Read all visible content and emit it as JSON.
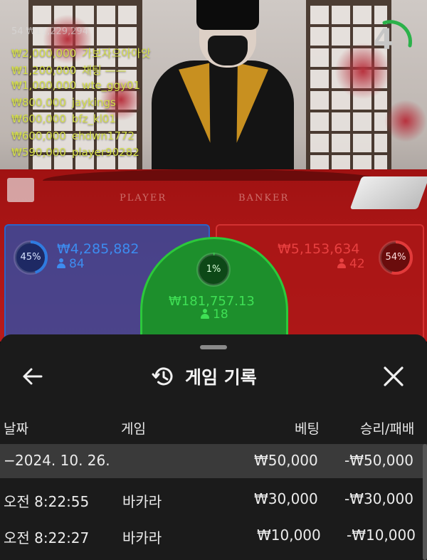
{
  "countdown": {
    "value": "4",
    "color": "#2bb14a"
  },
  "chat": {
    "header": "54 ₩11,229,294",
    "entries": [
      {
        "amount": "₩2,000,000",
        "user": "가보자으아아앗"
      },
      {
        "amount": "₩1,200,000",
        "user": "채팅 ——"
      },
      {
        "amount": "₩1,000,000",
        "user": "wte_ggy01"
      },
      {
        "amount": "₩800,000",
        "user": "jaykings"
      },
      {
        "amount": "₩600,000",
        "user": "bfz_kl01"
      },
      {
        "amount": "₩600,000",
        "user": "ehdwn1772"
      },
      {
        "amount": "₩590,000",
        "user": "player90282"
      }
    ]
  },
  "table": {
    "player_word": "PLAYER",
    "banker_word": "BANKER"
  },
  "bets": {
    "player": {
      "percent": "45%",
      "percent_value": 45,
      "amount": "₩4,285,882",
      "count": "84",
      "color": "#2f7be0"
    },
    "tie": {
      "percent": "1%",
      "percent_value": 1,
      "amount": "₩181,757.13",
      "count": "18",
      "color": "#35d24a"
    },
    "banker": {
      "percent": "54%",
      "percent_value": 54,
      "amount": "₩5,153,634",
      "count": "42",
      "color": "#e23a3a"
    }
  },
  "history": {
    "title": "게임 기록",
    "back_icon": "arrow-left-icon",
    "title_icon": "history-icon",
    "close_icon": "close-icon",
    "columns": {
      "date": "날짜",
      "game": "게임",
      "bet": "베팅",
      "result": "승리/패배"
    },
    "date_group": {
      "toggle": "−",
      "date": "2024. 10. 26.",
      "bet": "₩50,000",
      "result": "-₩50,000"
    },
    "rows": [
      {
        "time": "오전 8:22:55",
        "game": "바카라",
        "bet": "₩30,000",
        "result": "-₩30,000"
      },
      {
        "time": "오전 8:22:27",
        "game": "바카라",
        "bet": "₩10,000",
        "result": "-₩10,000"
      }
    ]
  }
}
